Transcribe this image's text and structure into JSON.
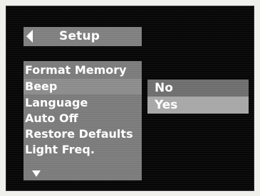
{
  "header": {
    "title": "Setup",
    "back_icon": "left-triangle-icon"
  },
  "menu": {
    "items": [
      {
        "label": "Format Memory"
      },
      {
        "label": "Beep"
      },
      {
        "label": "Language"
      },
      {
        "label": "Auto Off"
      },
      {
        "label": "Restore Defaults"
      },
      {
        "label": "Light Freq."
      }
    ],
    "selected_index": 1,
    "scroll_icon": "down-triangle-icon"
  },
  "submenu": {
    "options": [
      {
        "label": "No"
      },
      {
        "label": "Yes"
      }
    ],
    "selected_index": 1
  },
  "colors": {
    "screen_background": "#060606",
    "panel": "#7b7b7b",
    "highlight": "#a7a7a7",
    "text": "#ffffff"
  }
}
